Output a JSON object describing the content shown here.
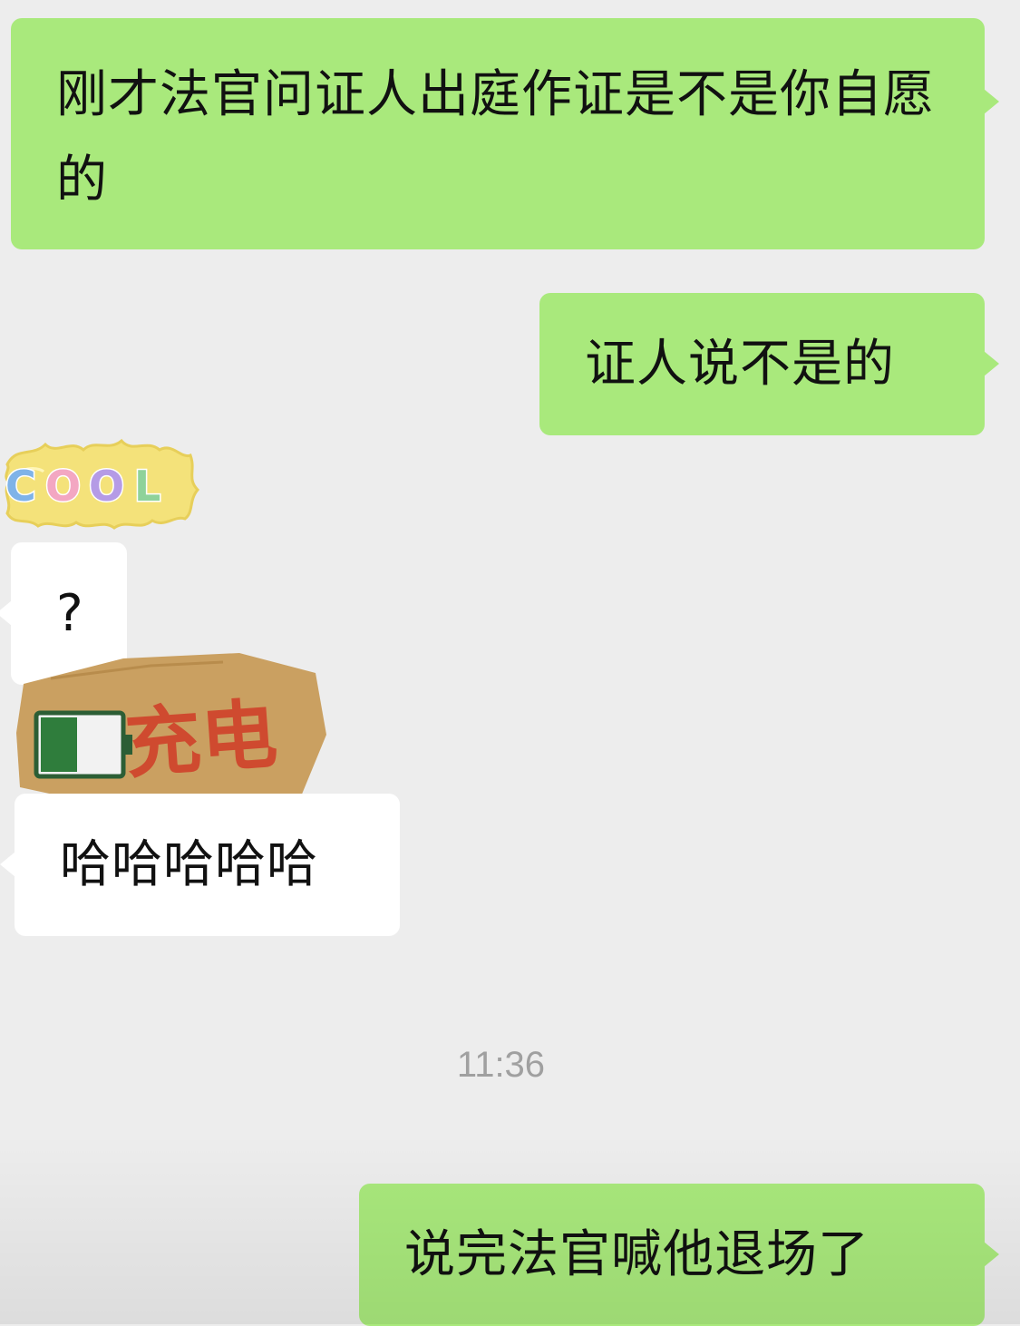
{
  "messages": [
    {
      "id": "m1",
      "side": "sent",
      "kind": "text",
      "text": "刚才法官问证人出庭作证是不是你自愿的"
    },
    {
      "id": "m2",
      "side": "sent",
      "kind": "text",
      "text": "证人说不是的"
    },
    {
      "id": "m3",
      "side": "received",
      "kind": "sticker",
      "sticker_text": "COOL"
    },
    {
      "id": "m4",
      "side": "received",
      "kind": "text",
      "text": "?"
    },
    {
      "id": "m5",
      "side": "received",
      "kind": "sticker",
      "sticker_text": "充电",
      "icon": "battery-low-icon"
    },
    {
      "id": "m6",
      "side": "received",
      "kind": "text",
      "text": "哈哈哈哈哈"
    },
    {
      "id": "t1",
      "kind": "timestamp",
      "text": "11:36"
    },
    {
      "id": "m7",
      "side": "sent",
      "kind": "text",
      "text": "说完法官喊他退场了"
    }
  ],
  "colors": {
    "background": "#ededed",
    "sent_bubble": "#a9e97c",
    "received_bubble": "#ffffff",
    "timestamp": "#a0a0a0"
  }
}
